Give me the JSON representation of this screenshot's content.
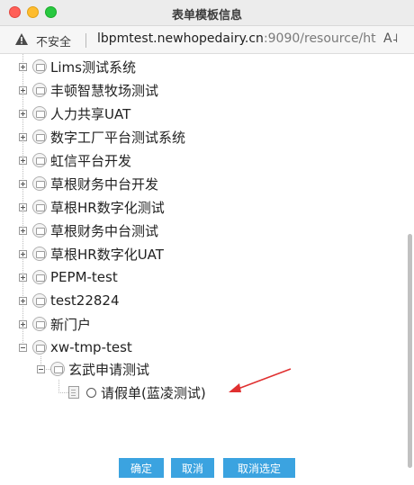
{
  "window": {
    "title": "表单模板信息"
  },
  "address_bar": {
    "security_label": "不安全",
    "url_host": "lbpmtest.newhopedairy.cn",
    "url_rest": ":9090/resource/ht...",
    "reader_icon": "reader-mode-icon"
  },
  "tree": {
    "items": [
      {
        "label": "Lims测试系统"
      },
      {
        "label": "丰顿智慧牧场测试"
      },
      {
        "label": "人力共享UAT"
      },
      {
        "label": "数字工厂平台测试系统"
      },
      {
        "label": "虹信平台开发"
      },
      {
        "label": "草根财务中台开发"
      },
      {
        "label": "草根HR数字化测试"
      },
      {
        "label": "草根财务中台测试"
      },
      {
        "label": "草根HR数字化UAT"
      },
      {
        "label": "PEPM-test"
      },
      {
        "label": "test22824"
      },
      {
        "label": "新门户"
      },
      {
        "label": "xw-tmp-test"
      }
    ],
    "child_folder": {
      "label": "玄武申请测试"
    },
    "leaf": {
      "label": "请假单(蓝凌测试)"
    }
  },
  "buttons": {
    "confirm": "确定",
    "cancel": "取消",
    "clear_selection": "取消选定"
  },
  "colors": {
    "button": "#3ba3e0",
    "annotation_arrow": "#e03030"
  }
}
